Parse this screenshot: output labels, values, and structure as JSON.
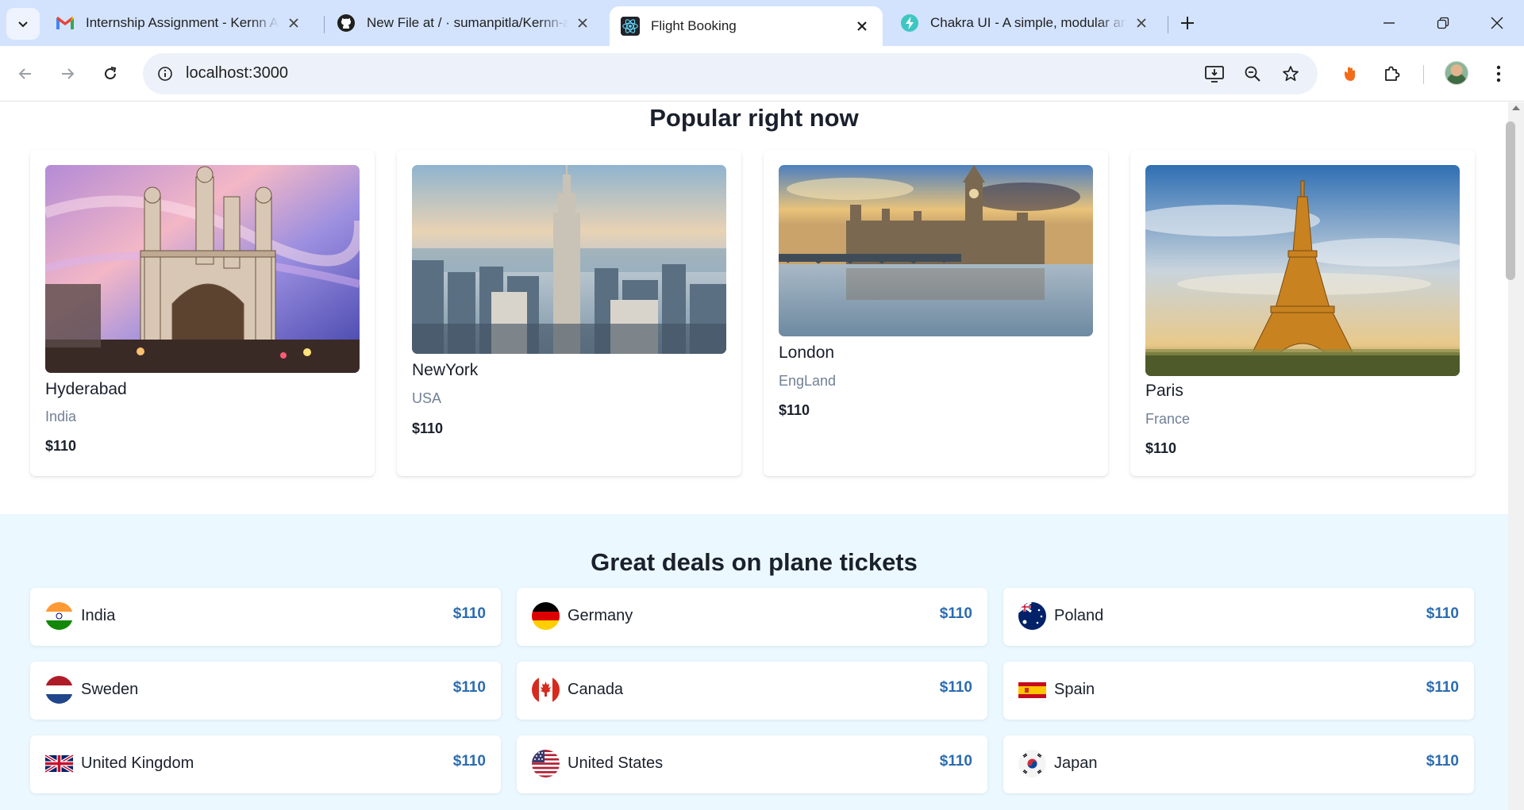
{
  "browser": {
    "tabs": [
      {
        "title": "Internship Assignment - Kernn Aut",
        "icon": "gmail-icon",
        "active": false
      },
      {
        "title": "New File at / · sumanpitla/Kernn-a",
        "icon": "github-icon",
        "active": false
      },
      {
        "title": "Flight Booking",
        "icon": "react-icon",
        "active": true
      },
      {
        "title": "Chakra UI - A simple, modular and",
        "icon": "chakra-icon",
        "active": false
      }
    ],
    "url": "localhost:3000",
    "colors": {
      "tabstrip": "#d3e3fd",
      "omnibox": "#edf2fa"
    }
  },
  "popular": {
    "title": "Popular right now",
    "cards": [
      {
        "city": "Hyderabad",
        "country": "India",
        "price": "$110",
        "image": "charminar-photo"
      },
      {
        "city": "NewYork",
        "country": "USA",
        "price": "$110",
        "image": "new-york-skyline-photo"
      },
      {
        "city": "London",
        "country": "EngLand",
        "price": "$110",
        "image": "westminster-photo"
      },
      {
        "city": "Paris",
        "country": "France",
        "price": "$110",
        "image": "eiffel-tower-photo"
      }
    ]
  },
  "deals": {
    "title": "Great deals on plane tickets",
    "background": "#ebf8ff",
    "price_color": "#2b6cb0",
    "items": [
      {
        "name": "India",
        "price": "$110",
        "flag": "india-flag-icon"
      },
      {
        "name": "Germany",
        "price": "$110",
        "flag": "germany-flag-icon"
      },
      {
        "name": "Poland",
        "price": "$110",
        "flag": "australia-flag-icon"
      },
      {
        "name": "Sweden",
        "price": "$110",
        "flag": "netherlands-flag-icon"
      },
      {
        "name": "Canada",
        "price": "$110",
        "flag": "canada-flag-icon"
      },
      {
        "name": "Spain",
        "price": "$110",
        "flag": "spain-flag-icon"
      },
      {
        "name": "United Kingdom",
        "price": "$110",
        "flag": "uk-flag-icon"
      },
      {
        "name": "United States",
        "price": "$110",
        "flag": "us-flag-icon"
      },
      {
        "name": "Japan",
        "price": "$110",
        "flag": "south-korea-flag-icon"
      }
    ]
  }
}
